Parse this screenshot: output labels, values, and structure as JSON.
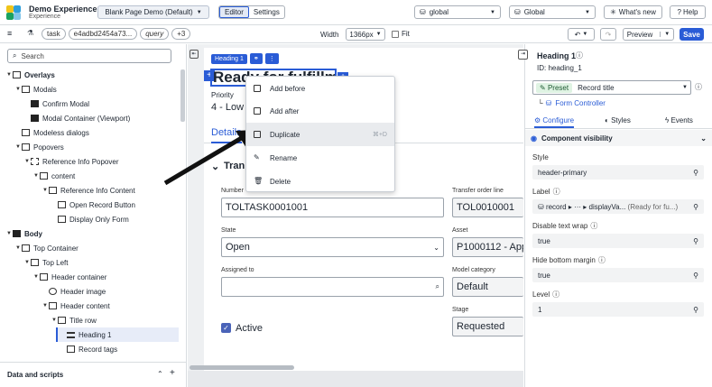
{
  "app": {
    "name": "Demo Experience",
    "subtitle": "Experience"
  },
  "page_select": "Blank Page Demo (Default)",
  "editor_tabs": [
    "Editor",
    "Settings"
  ],
  "scope_selects": [
    "global",
    "Global"
  ],
  "whats_new": "What's new",
  "help": "Help",
  "url_params": [
    "task",
    "e4adbd2454a73...",
    "query",
    "+3"
  ],
  "width_label": "Width",
  "width_value": "1366px",
  "fit_label": "Fit",
  "preview_label": "Preview",
  "save_label": "Save",
  "search_placeholder": "Search",
  "tree": [
    {
      "label": "Overlays",
      "bold": true
    },
    {
      "label": "Modals"
    },
    {
      "label": "Confirm Modal"
    },
    {
      "label": "Modal Container (Viewport)"
    },
    {
      "label": "Modeless dialogs"
    },
    {
      "label": "Popovers"
    },
    {
      "label": "Reference Info Popover"
    },
    {
      "label": "content"
    },
    {
      "label": "Reference Info Content"
    },
    {
      "label": "Open Record Button"
    },
    {
      "label": "Display Only Form"
    },
    {
      "label": "Body",
      "bold": true
    },
    {
      "label": "Top Container"
    },
    {
      "label": "Top Left"
    },
    {
      "label": "Header container"
    },
    {
      "label": "Header image"
    },
    {
      "label": "Header content"
    },
    {
      "label": "Title row"
    },
    {
      "label": "Heading 1"
    },
    {
      "label": "Record tags"
    }
  ],
  "data_scripts": "Data and scripts",
  "canvas": {
    "chip_label": "Heading 1",
    "heading": "Ready for fulfillment",
    "priority_label": "Priority",
    "priority_value": "4 - Low",
    "tab": "Details",
    "section": "Tran",
    "number_label": "Number",
    "number_value": "TOLTASK0001001",
    "transfer_label": "Transfer order line",
    "transfer_value": "TOL0010001",
    "state_label": "State",
    "state_value": "Open",
    "asset_label": "Asset",
    "asset_value": "P1000112 - App",
    "assigned_label": "Assigned to",
    "model_label": "Model category",
    "model_value": "Default",
    "stage_label": "Stage",
    "stage_value": "Requested",
    "active_label": "Active"
  },
  "context_menu": [
    {
      "label": "Add before",
      "icon": "add-before-icon"
    },
    {
      "label": "Add after",
      "icon": "add-after-icon"
    },
    {
      "label": "Duplicate",
      "icon": "duplicate-icon",
      "shortcut": "⌘+D"
    },
    {
      "label": "Rename",
      "icon": "rename-icon"
    },
    {
      "label": "Delete",
      "icon": "trash-icon"
    }
  ],
  "props": {
    "title": "Heading 1",
    "id": "ID: heading_1",
    "preset_tag": "Preset",
    "preset_value": "Record title",
    "form_controller": "Form Controller",
    "tabs": [
      "Configure",
      "Styles",
      "Events"
    ],
    "visibility": "Component visibility",
    "fields": [
      {
        "label": "Style",
        "value": "header-primary"
      },
      {
        "label": "Label",
        "value": "record ▸ ··· ▸ displayVa...",
        "hint": "(Ready for fu...)"
      },
      {
        "label": "Disable text wrap",
        "value": "true"
      },
      {
        "label": "Hide bottom margin",
        "value": "true"
      },
      {
        "label": "Level",
        "value": "1"
      }
    ]
  }
}
